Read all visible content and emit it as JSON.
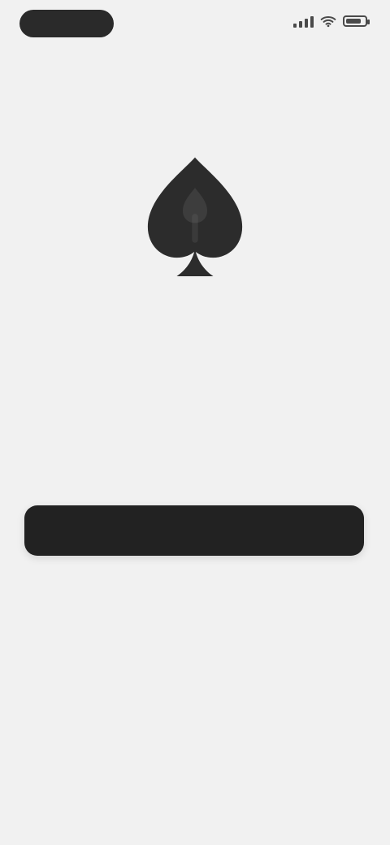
{
  "status_bar": {
    "icons": [
      "signal-icon",
      "wifi-icon",
      "battery-icon"
    ]
  },
  "hero": {
    "icon": "spade-icon",
    "top_text": "",
    "highlight_text": "",
    "description": "",
    "highlight_color": "#c7475f"
  },
  "actions": {
    "primary_label": "",
    "secondary_label": ""
  },
  "colors": {
    "background": "#f1f1f1",
    "button": "#222222",
    "icon": "#2c2c2c",
    "accent": "#c7475f"
  }
}
